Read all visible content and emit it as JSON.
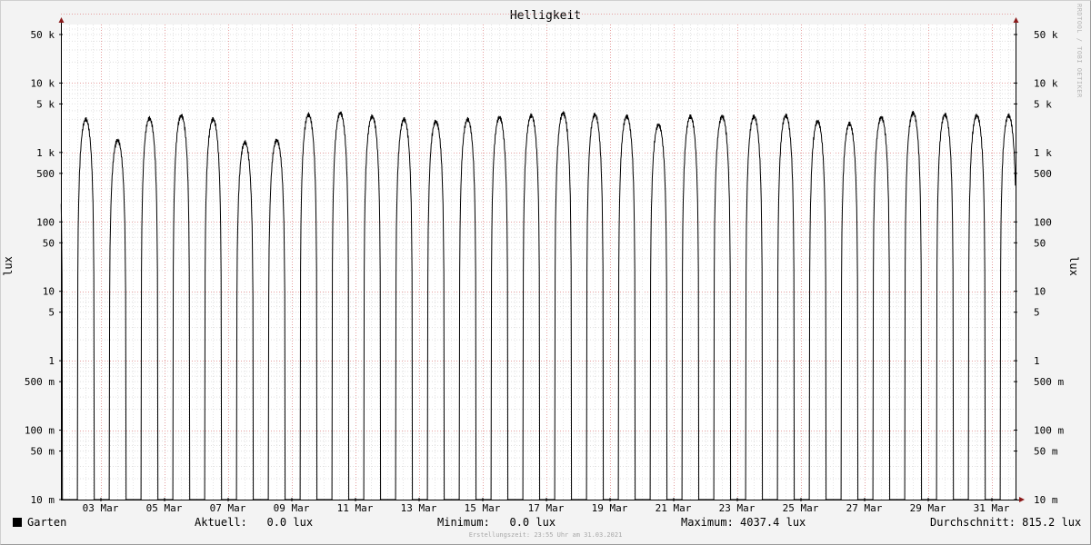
{
  "chart_data": {
    "type": "line",
    "title": "Helligkeit",
    "ylabel": "lux",
    "scale": "log",
    "ylim": [
      0.01,
      100000
    ],
    "y_ticks": [
      {
        "value": 0.01,
        "label": "10 m"
      },
      {
        "value": 0.05,
        "label": "50 m"
      },
      {
        "value": 0.1,
        "label": "100 m"
      },
      {
        "value": 0.5,
        "label": "500 m"
      },
      {
        "value": 1,
        "label": "1"
      },
      {
        "value": 5,
        "label": "5"
      },
      {
        "value": 10,
        "label": "10"
      },
      {
        "value": 50,
        "label": "50"
      },
      {
        "value": 100,
        "label": "100"
      },
      {
        "value": 500,
        "label": "500"
      },
      {
        "value": 1000,
        "label": "1 k"
      },
      {
        "value": 5000,
        "label": "5 k"
      },
      {
        "value": 10000,
        "label": "10 k"
      },
      {
        "value": 50000,
        "label": "50 k"
      }
    ],
    "x_range_days": [
      1,
      32
    ],
    "x_tick_labels": [
      "03 Mar",
      "05 Mar",
      "07 Mar",
      "09 Mar",
      "11 Mar",
      "13 Mar",
      "15 Mar",
      "17 Mar",
      "19 Mar",
      "21 Mar",
      "23 Mar",
      "25 Mar",
      "27 Mar",
      "29 Mar",
      "31 Mar"
    ],
    "x_tick_days": [
      3,
      5,
      7,
      9,
      11,
      13,
      15,
      17,
      19,
      21,
      23,
      25,
      27,
      29,
      31
    ],
    "grid": true,
    "series": [
      {
        "name": "Garten",
        "color": "#000000",
        "daily_peak_lux": [
          3200,
          3000,
          1500,
          3100,
          3400,
          3000,
          1400,
          1500,
          3500,
          3700,
          3300,
          3000,
          2800,
          3000,
          3200,
          3400,
          3700,
          3500,
          3300,
          2500,
          3300,
          3300,
          3300,
          3400,
          2800,
          2600,
          3200,
          3700,
          3500,
          3400,
          3400
        ]
      }
    ]
  },
  "legend": {
    "series_name": "Garten",
    "current": "Aktuell:   0.0 lux",
    "minimum": "Minimum:   0.0 lux",
    "maximum": "Maximum: 4037.4 lux",
    "average": "Durchschnitt: 815.2 lux"
  },
  "footer": "Erstellungszeit: 23:55 Uhr am 31.03.2021",
  "watermark": "RRDTOOL / TOBI OETIKER"
}
